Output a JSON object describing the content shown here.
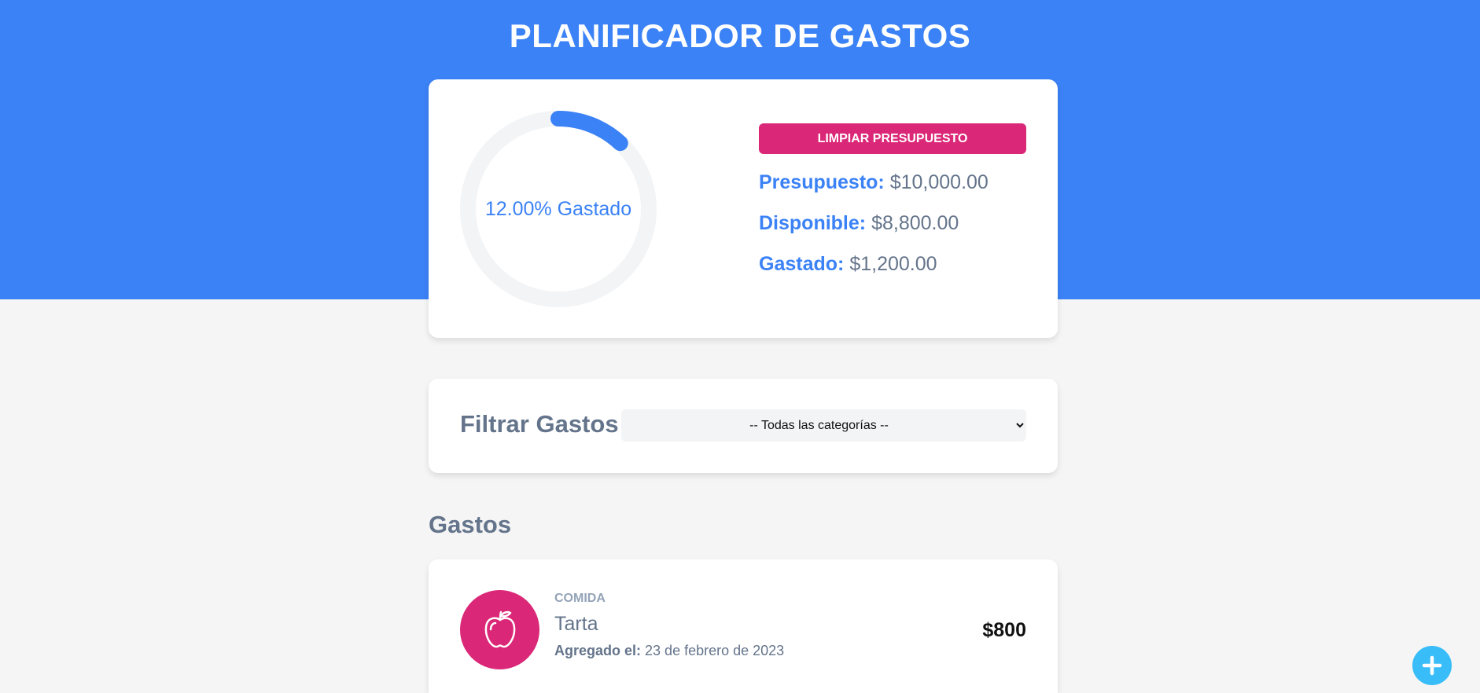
{
  "app": {
    "title": "PLANIFICADOR DE GASTOS"
  },
  "colors": {
    "header_bg": "#3b82f6",
    "accent": "#3b82f6",
    "danger": "#db2777",
    "fab": "#38bdf8",
    "page_bg": "#f5f5f5"
  },
  "budget": {
    "spent_fraction": 0.12,
    "progress_label": "12.00% Gastado",
    "reset_label": "LIMPIAR PRESUPUESTO",
    "budget_label": "Presupuesto:",
    "budget_value": "$10,000.00",
    "available_label": "Disponible:",
    "available_value": "$8,800.00",
    "spent_label": "Gastado:",
    "spent_value": "$1,200.00"
  },
  "filter": {
    "label": "Filtrar Gastos",
    "selected": "-- Todas las categorías --"
  },
  "expenses": {
    "title": "Gastos",
    "items": [
      {
        "category": "COMIDA",
        "name": "Tarta",
        "date_label": "Agregado el:",
        "date": "23 de febrero de 2023",
        "amount": "$800",
        "icon": "apple-icon"
      }
    ]
  },
  "fab": {
    "icon": "plus-icon"
  }
}
